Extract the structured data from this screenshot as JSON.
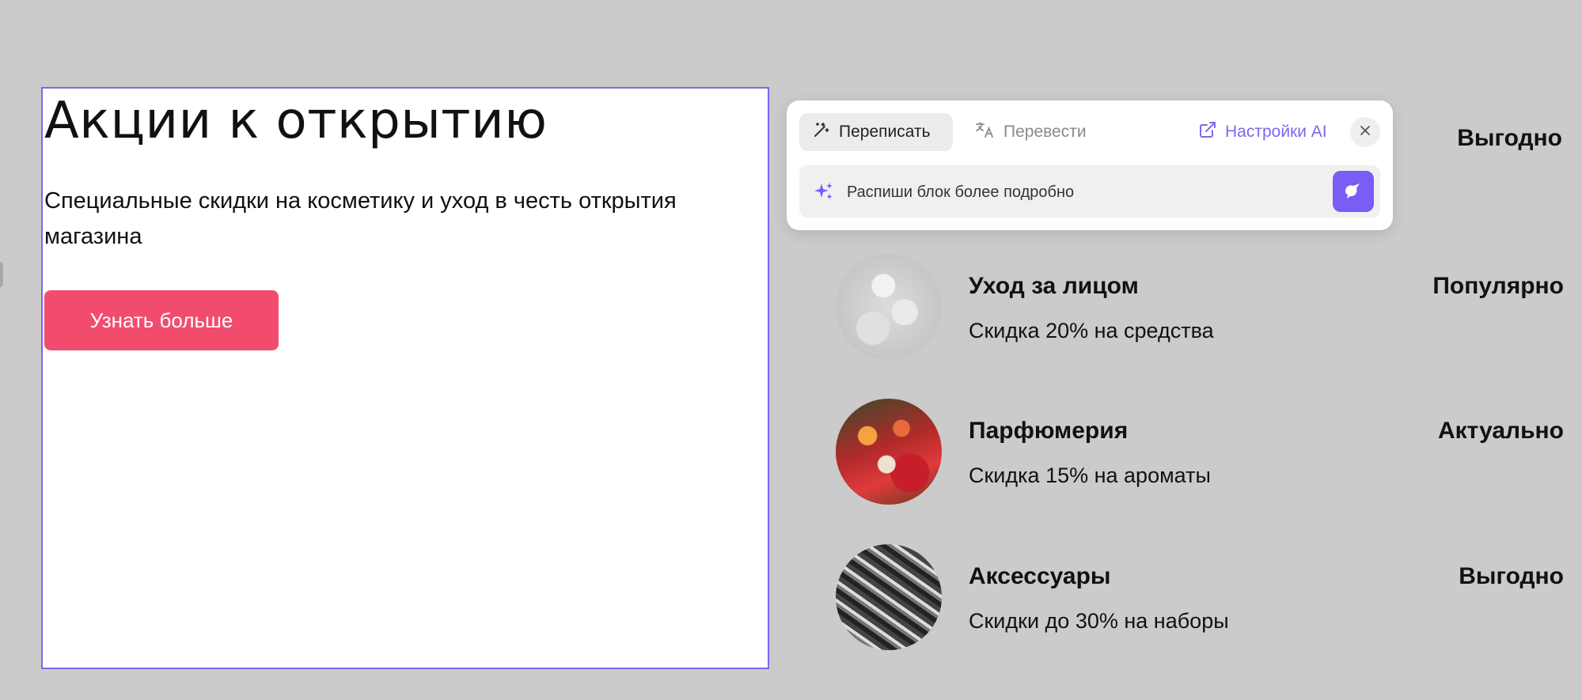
{
  "hero": {
    "title": "Акции к открытию",
    "subtitle": "Специальные скидки на косметику и уход в честь открытия магазина",
    "cta_label": "Узнать больше"
  },
  "ai_panel": {
    "tabs": [
      {
        "label": "Переписать",
        "icon": "magic-wand-icon",
        "active": true
      },
      {
        "label": "Перевести",
        "icon": "translate-icon",
        "active": false
      }
    ],
    "settings_label": "Настройки AI",
    "prompt_placeholder": "Распиши блок более подробно"
  },
  "promos": {
    "top_badge": "Выгодно",
    "items": [
      {
        "title": "Уход за лицом",
        "desc": "Скидка 20% на средства",
        "badge": "Популярно",
        "image": "face-care-photo"
      },
      {
        "title": "Парфюмерия",
        "desc": "Скидка 15% на ароматы",
        "badge": "Актуально",
        "image": "perfume-photo"
      },
      {
        "title": "Аксессуары",
        "desc": "Скидки до 30% на наборы",
        "badge": "Выгодно",
        "image": "accessories-photo"
      }
    ]
  },
  "colors": {
    "accent": "#7b68ee",
    "cta": "#f14c6e",
    "background": "#cbcbcb"
  }
}
